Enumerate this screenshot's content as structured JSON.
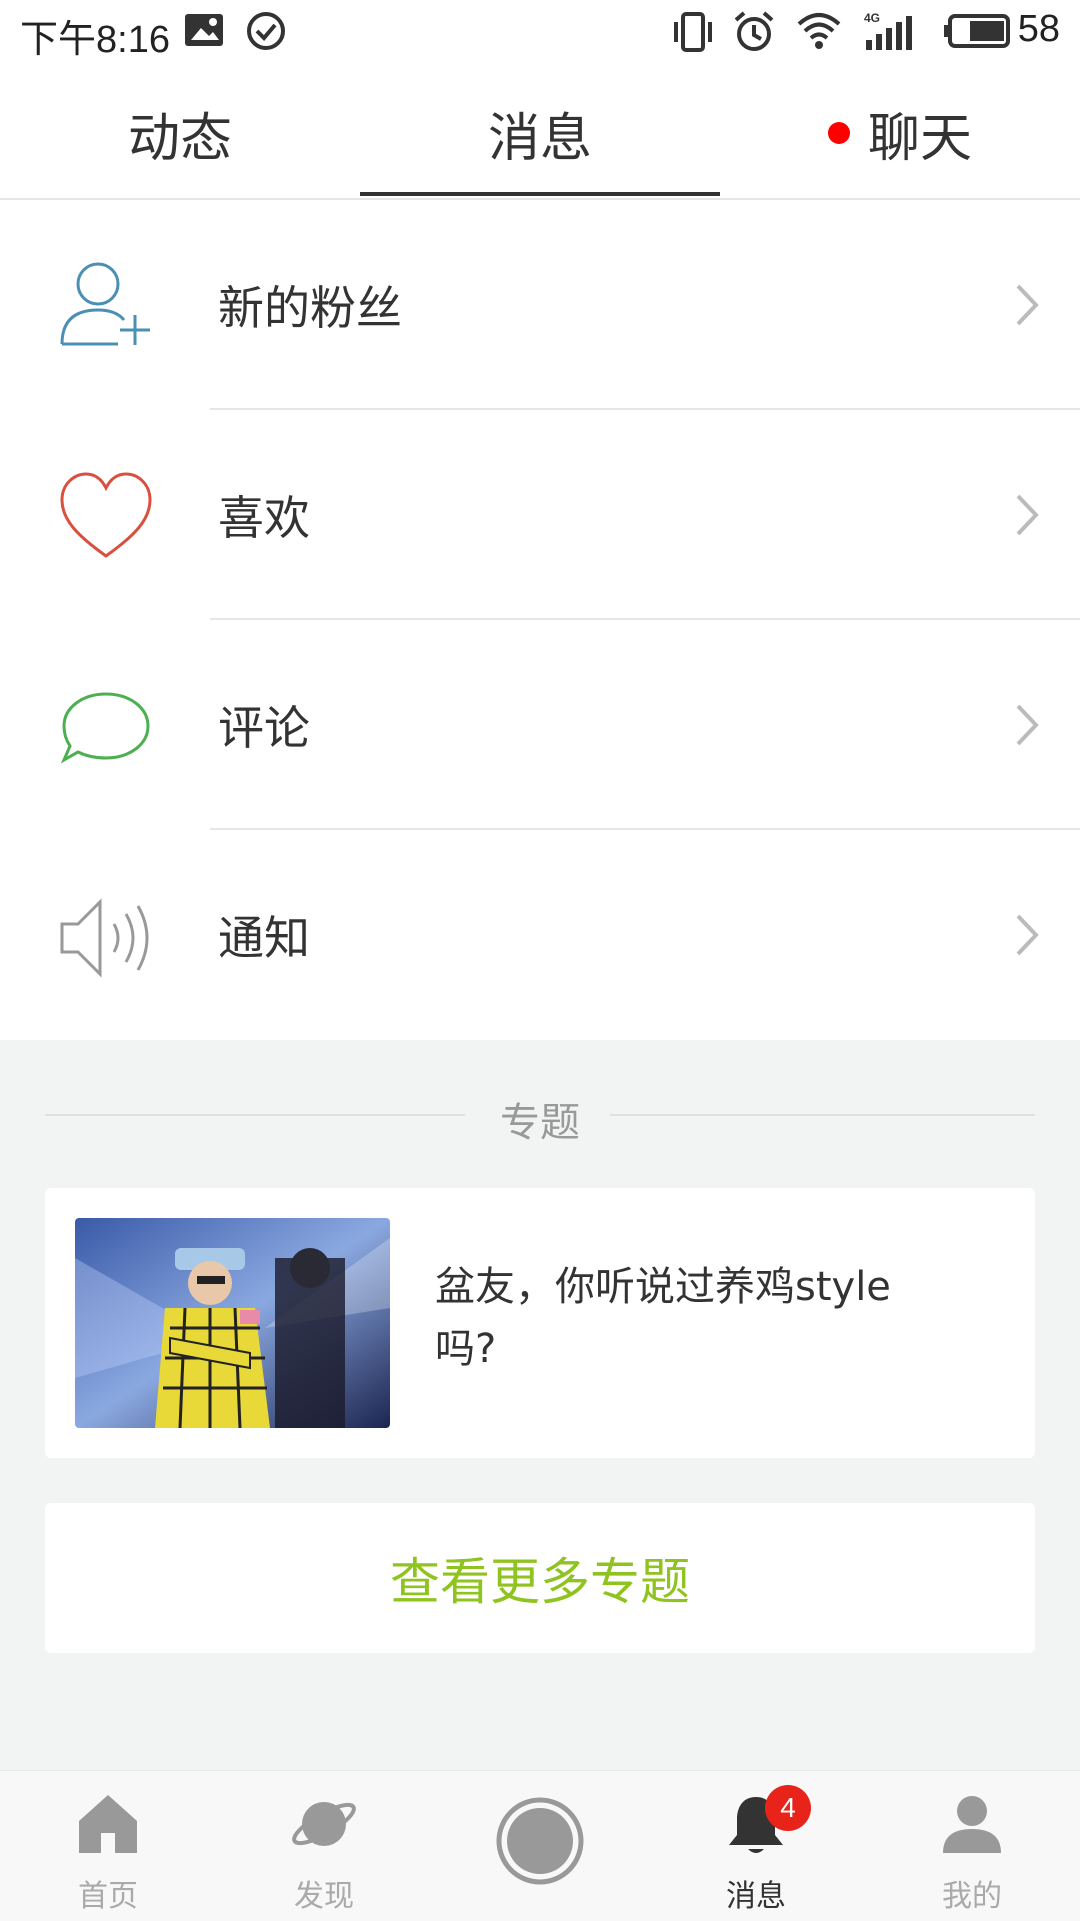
{
  "status_bar": {
    "time": "下午8:16",
    "network": "4G",
    "battery": "58"
  },
  "tabs": [
    {
      "label": "动态",
      "active": false
    },
    {
      "label": "消息",
      "active": true
    },
    {
      "label": "聊天",
      "active": false,
      "unread_dot": true
    }
  ],
  "message_list": [
    {
      "label": "新的粉丝",
      "icon": "add-user-icon",
      "color": "#4a8fb5"
    },
    {
      "label": "喜欢",
      "icon": "heart-icon",
      "color": "#d9503f"
    },
    {
      "label": "评论",
      "icon": "comment-bubble-icon",
      "color": "#4caf50"
    },
    {
      "label": "通知",
      "icon": "speaker-icon",
      "color": "#999999"
    }
  ],
  "topics": {
    "section_title": "专题",
    "card": {
      "text": "盆友，你听说过养鸡style吗?"
    },
    "more_button": "查看更多专题"
  },
  "bottom_nav": [
    {
      "label": "首页",
      "icon": "home-icon"
    },
    {
      "label": "发现",
      "icon": "planet-icon"
    },
    {
      "label": "",
      "icon": "record-button-icon"
    },
    {
      "label": "消息",
      "icon": "bell-icon",
      "badge": "4",
      "active": true
    },
    {
      "label": "我的",
      "icon": "profile-icon"
    }
  ],
  "colors": {
    "accent_green": "#8fc31f",
    "badge_red": "#e8231a"
  }
}
